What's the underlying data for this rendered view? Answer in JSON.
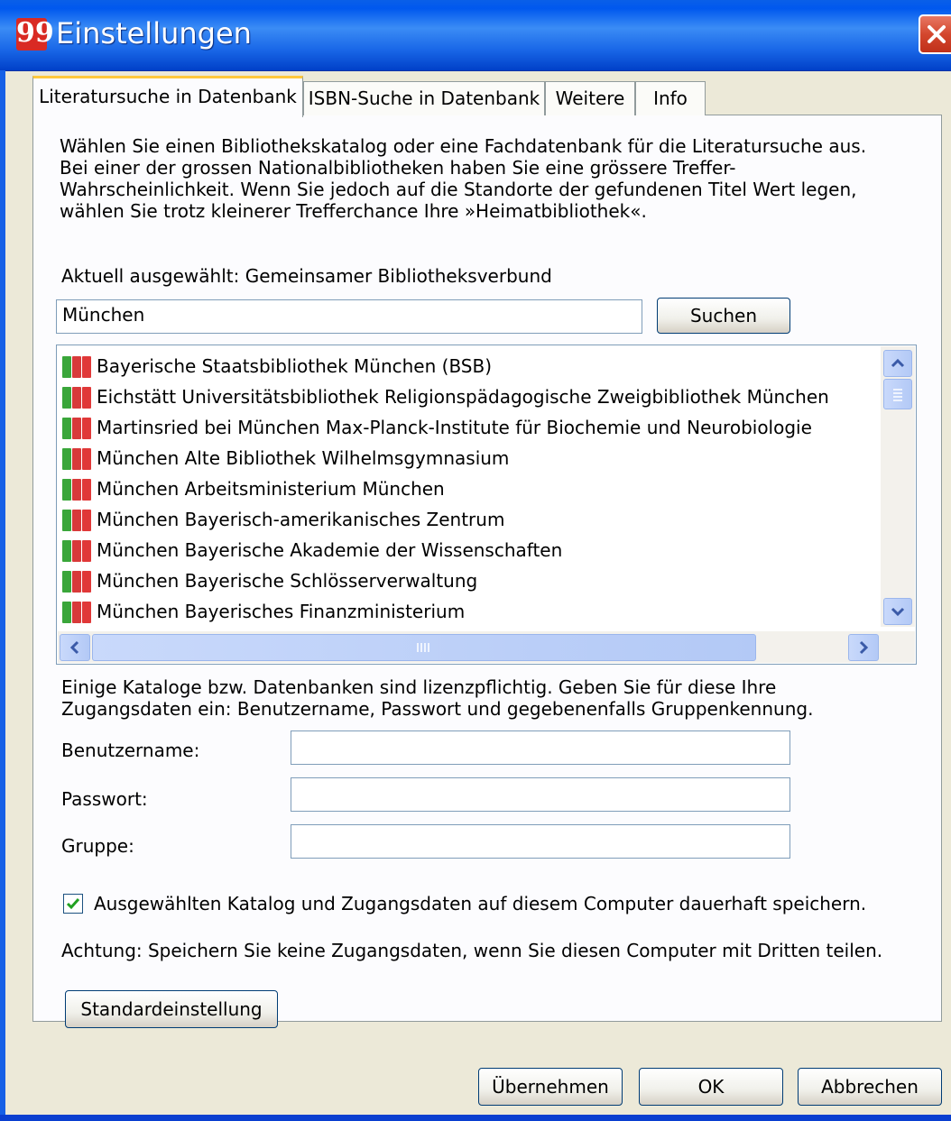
{
  "window": {
    "title": "Einstellungen",
    "icon_glyph": "99"
  },
  "tabs": [
    {
      "label": "Literatursuche in Datenbank"
    },
    {
      "label": "ISBN-Suche in Datenbank"
    },
    {
      "label": "Weitere"
    },
    {
      "label": "Info"
    }
  ],
  "intro": {
    "line1": "Wählen Sie einen Bibliothekskatalog oder eine Fachdatenbank für die Literatursuche aus.",
    "line2": "Bei einer der grossen Nationalbibliotheken haben Sie eine grössere Treffer-",
    "line3": "Wahrscheinlichkeit. Wenn Sie jedoch auf die Standorte der gefundenen Titel Wert legen,",
    "line4": "wählen Sie trotz kleinerer Trefferchance Ihre »Heimatbibliothek«."
  },
  "current_selection": "Aktuell ausgewählt: Gemeinsamer Bibliotheksverbund",
  "search": {
    "value": "München",
    "button_label": "Suchen"
  },
  "libraries": [
    {
      "label": "Bayerische Staatsbibliothek München (BSB)"
    },
    {
      "label": "Eichstätt Universitätsbibliothek Religionspädagogische Zweigbibliothek München"
    },
    {
      "label": "Martinsried bei München Max-Planck-Institute für Biochemie und Neurobiologie"
    },
    {
      "label": "München Alte Bibliothek Wilhelmsgymnasium"
    },
    {
      "label": "München Arbeitsministerium München"
    },
    {
      "label": "München Bayerisch-amerikanisches Zentrum"
    },
    {
      "label": "München Bayerische Akademie der Wissenschaften"
    },
    {
      "label": "München Bayerische Schlösserverwaltung"
    },
    {
      "label": "München Bayerisches Finanzministerium"
    }
  ],
  "license_note": {
    "line1": "Einige Kataloge bzw. Datenbanken sind lizenzpflichtig. Geben Sie für diese Ihre",
    "line2": "Zugangsdaten ein: Benutzername, Passwort und gegebenenfalls Gruppenkennung."
  },
  "fields": {
    "username_label": "Benutzername:",
    "username_value": "",
    "password_label": "Passwort:",
    "password_value": "",
    "group_label": "Gruppe:",
    "group_value": ""
  },
  "save_checkbox": {
    "label": "Ausgewählten Katalog und Zugangsdaten auf diesem Computer dauerhaft speichern.",
    "checked": true
  },
  "warning": "Achtung: Speichern Sie keine Zugangsdaten, wenn Sie diesen Computer mit Dritten teilen.",
  "default_button": "Standardeinstellung",
  "footer": {
    "apply": "Übernehmen",
    "ok": "OK",
    "cancel": "Abbrechen"
  },
  "colors": {
    "titlebar": "#0058ee",
    "tab_highlight": "#ffc83c",
    "close": "#d4472e",
    "window_bg": "#ece9d8"
  }
}
